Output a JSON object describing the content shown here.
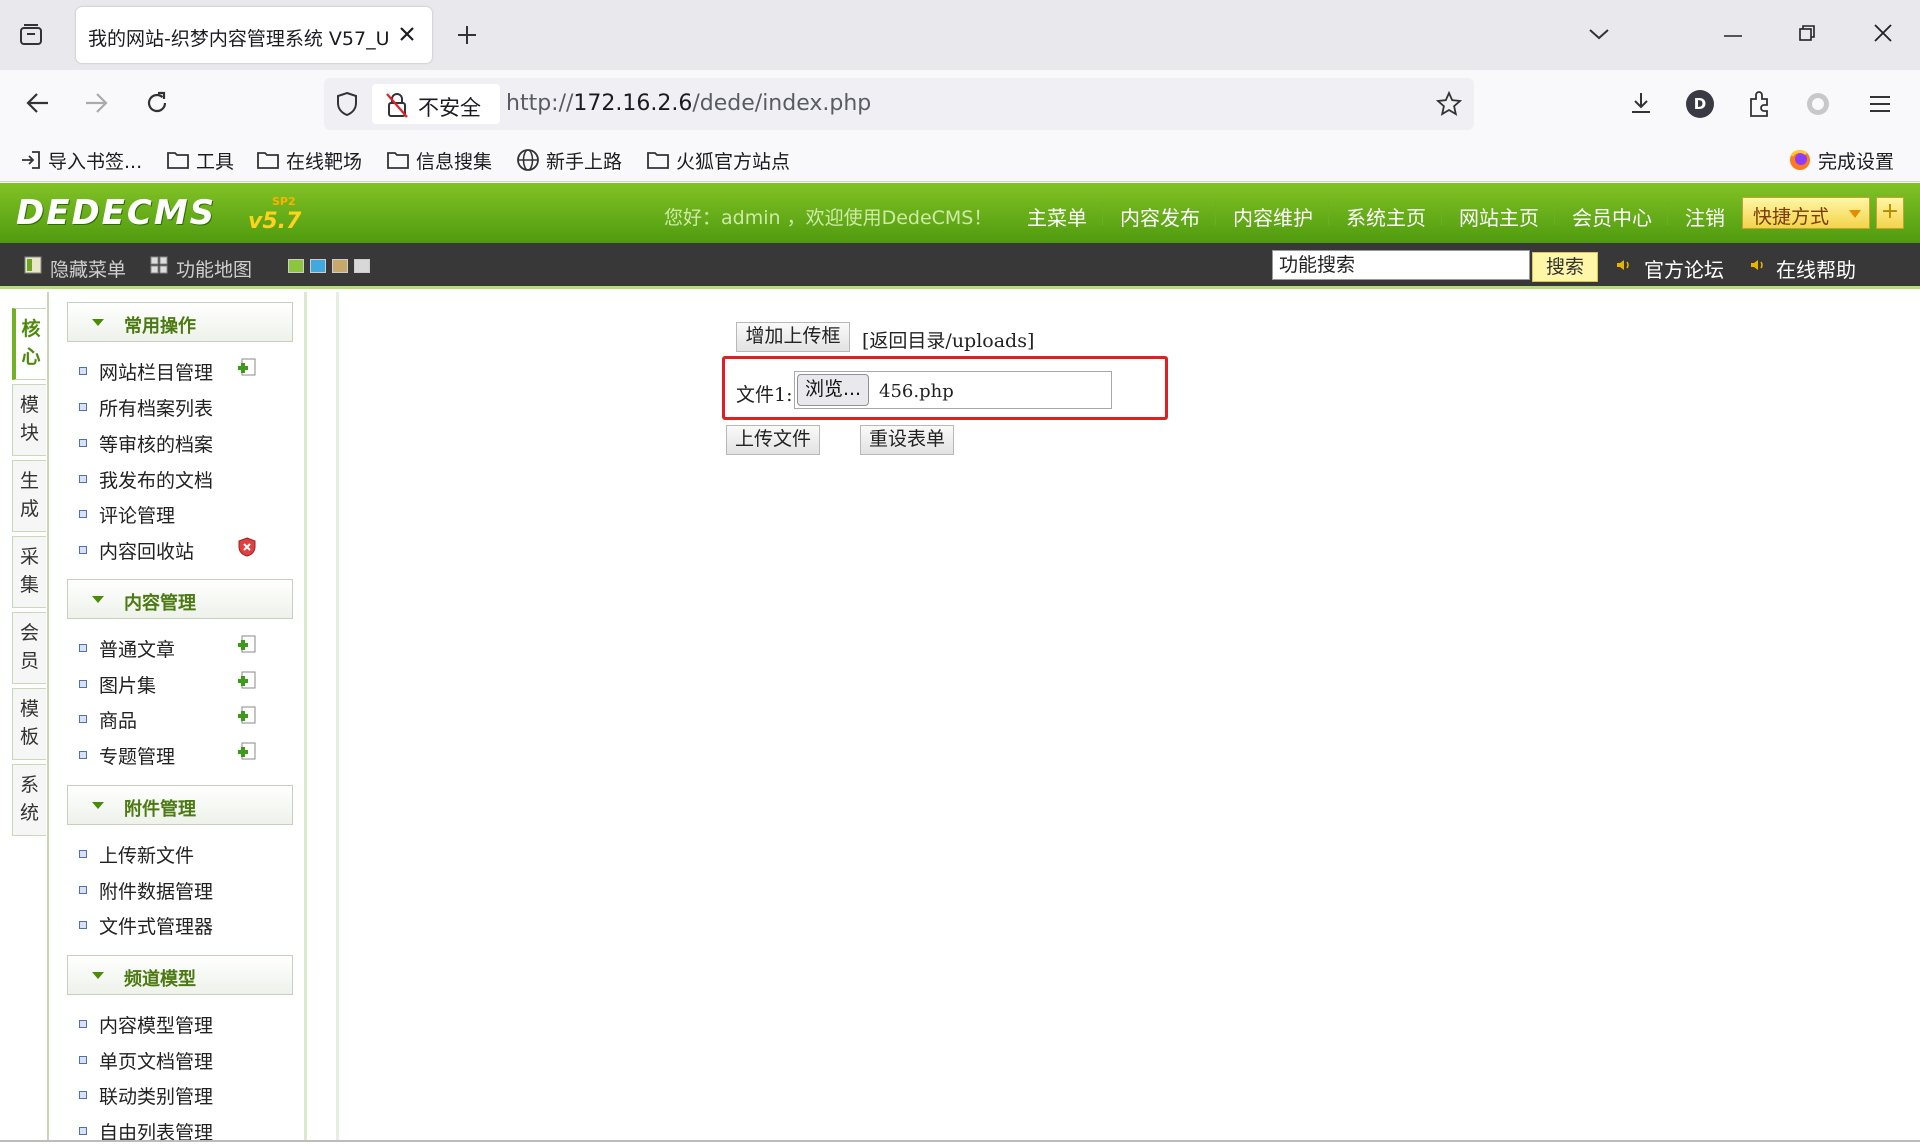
{
  "browser": {
    "tab_title": "我的网站-织梦内容管理系统 V57_U",
    "security_label": "不安全",
    "url_prefix": "http://",
    "url_host": "172.16.2.6",
    "url_path": "/dede/index.php",
    "avatar_letter": "D",
    "bookmarks": [
      "导入书签...",
      "工具",
      "在线靶场",
      "信息搜集",
      "新手上路",
      "火狐官方站点"
    ],
    "setup_label": "完成设置"
  },
  "header": {
    "logo": "DEDECMS",
    "version": "v5.7",
    "version_tag": "SP2",
    "welcome": "您好：admin ，欢迎使用DedeCMS！",
    "nav": [
      "主菜单",
      "内容发布",
      "内容维护",
      "系统主页",
      "网站主页",
      "会员中心",
      "注销"
    ],
    "quick_label": "快捷方式",
    "quick_plus": "+"
  },
  "subbar": {
    "hide_menu": "隐藏菜单",
    "site_map": "功能地图",
    "search_placeholder": "功能搜索",
    "search_button": "搜索",
    "forum": "官方论坛",
    "help": "在线帮助"
  },
  "side_tabs": [
    {
      "line1": "核",
      "line2": "心"
    },
    {
      "line1": "模",
      "line2": "块"
    },
    {
      "line1": "生",
      "line2": "成"
    },
    {
      "line1": "采",
      "line2": "集"
    },
    {
      "line1": "会",
      "line2": "员"
    },
    {
      "line1": "模",
      "line2": "板"
    },
    {
      "line1": "系",
      "line2": "统"
    }
  ],
  "menu": [
    {
      "title": "常用操作",
      "items": [
        "网站栏目管理",
        "所有档案列表",
        "等审核的档案",
        "我发布的文档",
        "评论管理",
        "内容回收站"
      ]
    },
    {
      "title": "内容管理",
      "items": [
        "普通文章",
        "图片集",
        "商品",
        "专题管理"
      ]
    },
    {
      "title": "附件管理",
      "items": [
        "上传新文件",
        "附件数据管理",
        "文件式管理器"
      ]
    },
    {
      "title": "频道模型",
      "items": [
        "内容模型管理",
        "单页文档管理",
        "联动类别管理",
        "自由列表管理"
      ]
    }
  ],
  "form": {
    "add_upload_box": "增加上传框",
    "back_link": "[返回目录/uploads]",
    "file_label": "文件1:",
    "browse_button": "浏览...",
    "file_name": "456.php",
    "upload_button": "上传文件",
    "reset_button": "重设表单"
  }
}
